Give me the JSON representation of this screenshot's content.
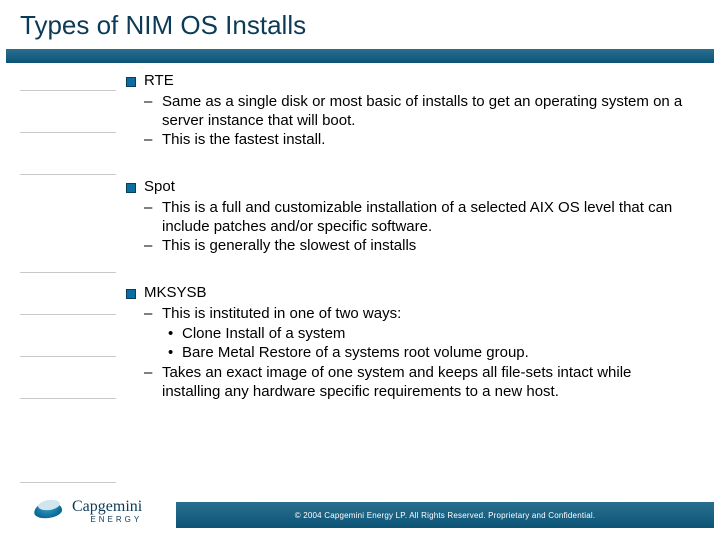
{
  "title": "Types of NIM OS Installs",
  "items": [
    {
      "label": "RTE",
      "subs": [
        {
          "text": "Same as a single disk or most basic of installs to get an operating system on a server instance that will boot."
        },
        {
          "text": "This is the fastest install."
        }
      ]
    },
    {
      "label": "Spot",
      "subs": [
        {
          "text": "This is a full and customizable installation of a selected AIX OS level that can include patches and/or specific software."
        },
        {
          "text": "This is generally the slowest of installs"
        }
      ]
    },
    {
      "label": "MKSYSB",
      "subs": [
        {
          "text": "This is instituted in one of two ways:",
          "subs": [
            {
              "text": "Clone Install of a system"
            },
            {
              "text": "Bare Metal Restore of a systems root volume group."
            }
          ]
        },
        {
          "text": "Takes an exact image of one system and keeps all file-sets intact while installing any hardware specific requirements to a new host."
        }
      ]
    }
  ],
  "footer": {
    "copyright": "© 2004 Capgemini Energy LP.  All Rights Reserved.  Proprietary and Confidential.",
    "logo_brand": "Capgemini",
    "logo_energy": "ENERGY"
  },
  "rule_positions": [
    24,
    66,
    108,
    206,
    248,
    290,
    332,
    416
  ]
}
